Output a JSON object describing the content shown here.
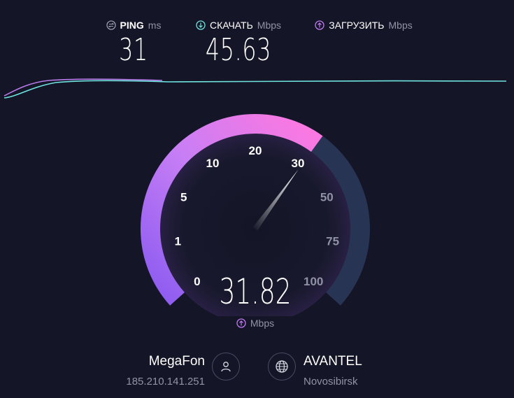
{
  "header": {
    "ping": {
      "label": "PING",
      "unit": "ms",
      "value": "31"
    },
    "download": {
      "label": "СКАЧАТЬ",
      "unit": "Mbps",
      "value": "45.63"
    },
    "upload": {
      "label": "ЗАГРУЗИТЬ",
      "unit": "Mbps",
      "value": ""
    }
  },
  "gauge": {
    "ticks": [
      "0",
      "1",
      "5",
      "10",
      "20",
      "30",
      "50",
      "75",
      "100"
    ],
    "value": "31.82",
    "unit": "Mbps",
    "level": 31.82
  },
  "provider": {
    "name": "MegaFon",
    "ip": "185.210.141.251"
  },
  "server": {
    "name": "AVANTEL",
    "location": "Novosibirsk"
  },
  "colors": {
    "ping": "#9a9cb0",
    "download": "#6fe3e0",
    "upload": "#c07bf0",
    "arc_start": "#8a5af0",
    "arc_end": "#ff78e0",
    "arc_track": "#283454",
    "background": "#141526"
  },
  "icons": {
    "ping": "ping-icon",
    "download": "download-arrow-icon",
    "upload": "upload-arrow-icon",
    "isp": "user-icon",
    "server": "globe-icon"
  }
}
